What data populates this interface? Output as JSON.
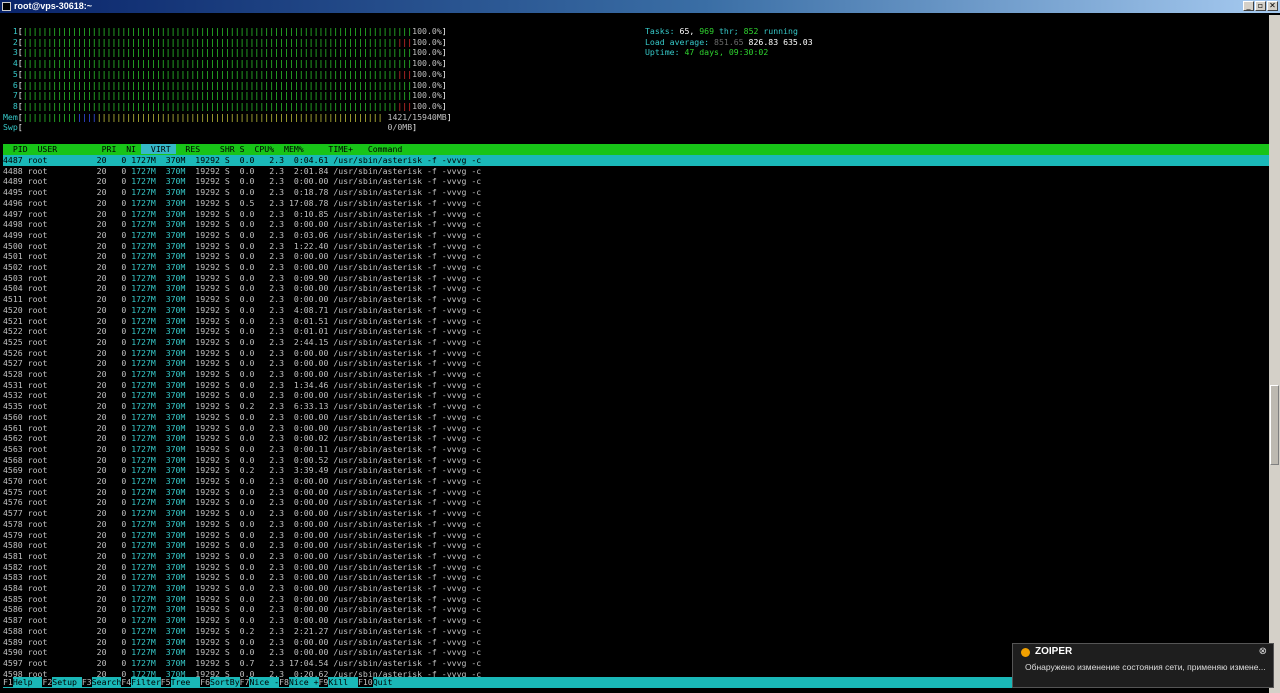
{
  "window": {
    "title": "root@vps-30618:~",
    "controls": [
      "_",
      "▫",
      "✕"
    ]
  },
  "htop": {
    "cpus": [
      {
        "id": "1",
        "percent": "100.0%"
      },
      {
        "id": "2",
        "percent": "100.0%"
      },
      {
        "id": "3",
        "percent": "100.0%"
      },
      {
        "id": "4",
        "percent": "100.0%"
      },
      {
        "id": "5",
        "percent": "100.0%"
      },
      {
        "id": "6",
        "percent": "100.0%"
      },
      {
        "id": "7",
        "percent": "100.0%"
      },
      {
        "id": "8",
        "percent": "100.0%"
      }
    ],
    "mem": {
      "label": "Mem",
      "value": "1421/15940MB"
    },
    "swp": {
      "label": "Swp",
      "value": "0/0MB"
    },
    "tasks": {
      "label": "Tasks:",
      "count": "65,",
      "threads": "969",
      "thr_label": "thr;",
      "running": "852",
      "running_label": "running"
    },
    "load": {
      "label": "Load average:",
      "v1": "851.65",
      "v5": "826.83",
      "v15": "635.03"
    },
    "uptime": {
      "label": "Uptime:",
      "value": "47 days, 09:30:02"
    },
    "columns": [
      "PID",
      "USER",
      "PRI",
      "NI",
      "VIRT",
      "RES",
      "SHR",
      "S",
      "CPU%",
      "MEM%",
      "TIME+",
      "Command"
    ],
    "sort_column": "VIRT",
    "processes": [
      {
        "pid": "4487",
        "user": "root",
        "pri": "20",
        "ni": "0",
        "virt": "1727M",
        "res": "370M",
        "shr": "19292",
        "s": "S",
        "cpu": "0.0",
        "mem": "2.3",
        "time": "0:04.61",
        "cmd": "/usr/sbin/asterisk -f -vvvg -c"
      },
      {
        "pid": "4488",
        "user": "root",
        "pri": "20",
        "ni": "0",
        "virt": "1727M",
        "res": "370M",
        "shr": "19292",
        "s": "S",
        "cpu": "0.0",
        "mem": "2.3",
        "time": "2:01.84",
        "cmd": "/usr/sbin/asterisk -f -vvvg -c"
      },
      {
        "pid": "4489",
        "user": "root",
        "pri": "20",
        "ni": "0",
        "virt": "1727M",
        "res": "370M",
        "shr": "19292",
        "s": "S",
        "cpu": "0.0",
        "mem": "2.3",
        "time": "0:00.00",
        "cmd": "/usr/sbin/asterisk -f -vvvg -c"
      },
      {
        "pid": "4495",
        "user": "root",
        "pri": "20",
        "ni": "0",
        "virt": "1727M",
        "res": "370M",
        "shr": "19292",
        "s": "S",
        "cpu": "0.0",
        "mem": "2.3",
        "time": "0:18.78",
        "cmd": "/usr/sbin/asterisk -f -vvvg -c"
      },
      {
        "pid": "4496",
        "user": "root",
        "pri": "20",
        "ni": "0",
        "virt": "1727M",
        "res": "370M",
        "shr": "19292",
        "s": "S",
        "cpu": "0.5",
        "mem": "2.3",
        "time": "17:08.78",
        "cmd": "/usr/sbin/asterisk -f -vvvg -c"
      },
      {
        "pid": "4497",
        "user": "root",
        "pri": "20",
        "ni": "0",
        "virt": "1727M",
        "res": "370M",
        "shr": "19292",
        "s": "S",
        "cpu": "0.0",
        "mem": "2.3",
        "time": "0:10.85",
        "cmd": "/usr/sbin/asterisk -f -vvvg -c"
      },
      {
        "pid": "4498",
        "user": "root",
        "pri": "20",
        "ni": "0",
        "virt": "1727M",
        "res": "370M",
        "shr": "19292",
        "s": "S",
        "cpu": "0.0",
        "mem": "2.3",
        "time": "0:00.00",
        "cmd": "/usr/sbin/asterisk -f -vvvg -c"
      },
      {
        "pid": "4499",
        "user": "root",
        "pri": "20",
        "ni": "0",
        "virt": "1727M",
        "res": "370M",
        "shr": "19292",
        "s": "S",
        "cpu": "0.0",
        "mem": "2.3",
        "time": "0:03.06",
        "cmd": "/usr/sbin/asterisk -f -vvvg -c"
      },
      {
        "pid": "4500",
        "user": "root",
        "pri": "20",
        "ni": "0",
        "virt": "1727M",
        "res": "370M",
        "shr": "19292",
        "s": "S",
        "cpu": "0.0",
        "mem": "2.3",
        "time": "1:22.40",
        "cmd": "/usr/sbin/asterisk -f -vvvg -c"
      },
      {
        "pid": "4501",
        "user": "root",
        "pri": "20",
        "ni": "0",
        "virt": "1727M",
        "res": "370M",
        "shr": "19292",
        "s": "S",
        "cpu": "0.0",
        "mem": "2.3",
        "time": "0:00.00",
        "cmd": "/usr/sbin/asterisk -f -vvvg -c"
      },
      {
        "pid": "4502",
        "user": "root",
        "pri": "20",
        "ni": "0",
        "virt": "1727M",
        "res": "370M",
        "shr": "19292",
        "s": "S",
        "cpu": "0.0",
        "mem": "2.3",
        "time": "0:00.00",
        "cmd": "/usr/sbin/asterisk -f -vvvg -c"
      },
      {
        "pid": "4503",
        "user": "root",
        "pri": "20",
        "ni": "0",
        "virt": "1727M",
        "res": "370M",
        "shr": "19292",
        "s": "S",
        "cpu": "0.0",
        "mem": "2.3",
        "time": "0:09.90",
        "cmd": "/usr/sbin/asterisk -f -vvvg -c"
      },
      {
        "pid": "4504",
        "user": "root",
        "pri": "20",
        "ni": "0",
        "virt": "1727M",
        "res": "370M",
        "shr": "19292",
        "s": "S",
        "cpu": "0.0",
        "mem": "2.3",
        "time": "0:00.00",
        "cmd": "/usr/sbin/asterisk -f -vvvg -c"
      },
      {
        "pid": "4511",
        "user": "root",
        "pri": "20",
        "ni": "0",
        "virt": "1727M",
        "res": "370M",
        "shr": "19292",
        "s": "S",
        "cpu": "0.0",
        "mem": "2.3",
        "time": "0:00.00",
        "cmd": "/usr/sbin/asterisk -f -vvvg -c"
      },
      {
        "pid": "4520",
        "user": "root",
        "pri": "20",
        "ni": "0",
        "virt": "1727M",
        "res": "370M",
        "shr": "19292",
        "s": "S",
        "cpu": "0.0",
        "mem": "2.3",
        "time": "4:08.71",
        "cmd": "/usr/sbin/asterisk -f -vvvg -c"
      },
      {
        "pid": "4521",
        "user": "root",
        "pri": "20",
        "ni": "0",
        "virt": "1727M",
        "res": "370M",
        "shr": "19292",
        "s": "S",
        "cpu": "0.0",
        "mem": "2.3",
        "time": "0:01.51",
        "cmd": "/usr/sbin/asterisk -f -vvvg -c"
      },
      {
        "pid": "4522",
        "user": "root",
        "pri": "20",
        "ni": "0",
        "virt": "1727M",
        "res": "370M",
        "shr": "19292",
        "s": "S",
        "cpu": "0.0",
        "mem": "2.3",
        "time": "0:01.01",
        "cmd": "/usr/sbin/asterisk -f -vvvg -c"
      },
      {
        "pid": "4525",
        "user": "root",
        "pri": "20",
        "ni": "0",
        "virt": "1727M",
        "res": "370M",
        "shr": "19292",
        "s": "S",
        "cpu": "0.0",
        "mem": "2.3",
        "time": "2:44.15",
        "cmd": "/usr/sbin/asterisk -f -vvvg -c"
      },
      {
        "pid": "4526",
        "user": "root",
        "pri": "20",
        "ni": "0",
        "virt": "1727M",
        "res": "370M",
        "shr": "19292",
        "s": "S",
        "cpu": "0.0",
        "mem": "2.3",
        "time": "0:00.00",
        "cmd": "/usr/sbin/asterisk -f -vvvg -c"
      },
      {
        "pid": "4527",
        "user": "root",
        "pri": "20",
        "ni": "0",
        "virt": "1727M",
        "res": "370M",
        "shr": "19292",
        "s": "S",
        "cpu": "0.0",
        "mem": "2.3",
        "time": "0:00.00",
        "cmd": "/usr/sbin/asterisk -f -vvvg -c"
      },
      {
        "pid": "4528",
        "user": "root",
        "pri": "20",
        "ni": "0",
        "virt": "1727M",
        "res": "370M",
        "shr": "19292",
        "s": "S",
        "cpu": "0.0",
        "mem": "2.3",
        "time": "0:00.00",
        "cmd": "/usr/sbin/asterisk -f -vvvg -c"
      },
      {
        "pid": "4531",
        "user": "root",
        "pri": "20",
        "ni": "0",
        "virt": "1727M",
        "res": "370M",
        "shr": "19292",
        "s": "S",
        "cpu": "0.0",
        "mem": "2.3",
        "time": "1:34.46",
        "cmd": "/usr/sbin/asterisk -f -vvvg -c"
      },
      {
        "pid": "4532",
        "user": "root",
        "pri": "20",
        "ni": "0",
        "virt": "1727M",
        "res": "370M",
        "shr": "19292",
        "s": "S",
        "cpu": "0.0",
        "mem": "2.3",
        "time": "0:00.00",
        "cmd": "/usr/sbin/asterisk -f -vvvg -c"
      },
      {
        "pid": "4535",
        "user": "root",
        "pri": "20",
        "ni": "0",
        "virt": "1727M",
        "res": "370M",
        "shr": "19292",
        "s": "S",
        "cpu": "0.2",
        "mem": "2.3",
        "time": "6:33.13",
        "cmd": "/usr/sbin/asterisk -f -vvvg -c"
      },
      {
        "pid": "4560",
        "user": "root",
        "pri": "20",
        "ni": "0",
        "virt": "1727M",
        "res": "370M",
        "shr": "19292",
        "s": "S",
        "cpu": "0.0",
        "mem": "2.3",
        "time": "0:00.00",
        "cmd": "/usr/sbin/asterisk -f -vvvg -c"
      },
      {
        "pid": "4561",
        "user": "root",
        "pri": "20",
        "ni": "0",
        "virt": "1727M",
        "res": "370M",
        "shr": "19292",
        "s": "S",
        "cpu": "0.0",
        "mem": "2.3",
        "time": "0:00.00",
        "cmd": "/usr/sbin/asterisk -f -vvvg -c"
      },
      {
        "pid": "4562",
        "user": "root",
        "pri": "20",
        "ni": "0",
        "virt": "1727M",
        "res": "370M",
        "shr": "19292",
        "s": "S",
        "cpu": "0.0",
        "mem": "2.3",
        "time": "0:00.02",
        "cmd": "/usr/sbin/asterisk -f -vvvg -c"
      },
      {
        "pid": "4563",
        "user": "root",
        "pri": "20",
        "ni": "0",
        "virt": "1727M",
        "res": "370M",
        "shr": "19292",
        "s": "S",
        "cpu": "0.0",
        "mem": "2.3",
        "time": "0:00.11",
        "cmd": "/usr/sbin/asterisk -f -vvvg -c"
      },
      {
        "pid": "4568",
        "user": "root",
        "pri": "20",
        "ni": "0",
        "virt": "1727M",
        "res": "370M",
        "shr": "19292",
        "s": "S",
        "cpu": "0.0",
        "mem": "2.3",
        "time": "0:00.52",
        "cmd": "/usr/sbin/asterisk -f -vvvg -c"
      },
      {
        "pid": "4569",
        "user": "root",
        "pri": "20",
        "ni": "0",
        "virt": "1727M",
        "res": "370M",
        "shr": "19292",
        "s": "S",
        "cpu": "0.2",
        "mem": "2.3",
        "time": "3:39.49",
        "cmd": "/usr/sbin/asterisk -f -vvvg -c"
      },
      {
        "pid": "4570",
        "user": "root",
        "pri": "20",
        "ni": "0",
        "virt": "1727M",
        "res": "370M",
        "shr": "19292",
        "s": "S",
        "cpu": "0.0",
        "mem": "2.3",
        "time": "0:00.00",
        "cmd": "/usr/sbin/asterisk -f -vvvg -c"
      },
      {
        "pid": "4575",
        "user": "root",
        "pri": "20",
        "ni": "0",
        "virt": "1727M",
        "res": "370M",
        "shr": "19292",
        "s": "S",
        "cpu": "0.0",
        "mem": "2.3",
        "time": "0:00.00",
        "cmd": "/usr/sbin/asterisk -f -vvvg -c"
      },
      {
        "pid": "4576",
        "user": "root",
        "pri": "20",
        "ni": "0",
        "virt": "1727M",
        "res": "370M",
        "shr": "19292",
        "s": "S",
        "cpu": "0.0",
        "mem": "2.3",
        "time": "0:00.00",
        "cmd": "/usr/sbin/asterisk -f -vvvg -c"
      },
      {
        "pid": "4577",
        "user": "root",
        "pri": "20",
        "ni": "0",
        "virt": "1727M",
        "res": "370M",
        "shr": "19292",
        "s": "S",
        "cpu": "0.0",
        "mem": "2.3",
        "time": "0:00.00",
        "cmd": "/usr/sbin/asterisk -f -vvvg -c"
      },
      {
        "pid": "4578",
        "user": "root",
        "pri": "20",
        "ni": "0",
        "virt": "1727M",
        "res": "370M",
        "shr": "19292",
        "s": "S",
        "cpu": "0.0",
        "mem": "2.3",
        "time": "0:00.00",
        "cmd": "/usr/sbin/asterisk -f -vvvg -c"
      },
      {
        "pid": "4579",
        "user": "root",
        "pri": "20",
        "ni": "0",
        "virt": "1727M",
        "res": "370M",
        "shr": "19292",
        "s": "S",
        "cpu": "0.0",
        "mem": "2.3",
        "time": "0:00.00",
        "cmd": "/usr/sbin/asterisk -f -vvvg -c"
      },
      {
        "pid": "4580",
        "user": "root",
        "pri": "20",
        "ni": "0",
        "virt": "1727M",
        "res": "370M",
        "shr": "19292",
        "s": "S",
        "cpu": "0.0",
        "mem": "2.3",
        "time": "0:00.00",
        "cmd": "/usr/sbin/asterisk -f -vvvg -c"
      },
      {
        "pid": "4581",
        "user": "root",
        "pri": "20",
        "ni": "0",
        "virt": "1727M",
        "res": "370M",
        "shr": "19292",
        "s": "S",
        "cpu": "0.0",
        "mem": "2.3",
        "time": "0:00.00",
        "cmd": "/usr/sbin/asterisk -f -vvvg -c"
      },
      {
        "pid": "4582",
        "user": "root",
        "pri": "20",
        "ni": "0",
        "virt": "1727M",
        "res": "370M",
        "shr": "19292",
        "s": "S",
        "cpu": "0.0",
        "mem": "2.3",
        "time": "0:00.00",
        "cmd": "/usr/sbin/asterisk -f -vvvg -c"
      },
      {
        "pid": "4583",
        "user": "root",
        "pri": "20",
        "ni": "0",
        "virt": "1727M",
        "res": "370M",
        "shr": "19292",
        "s": "S",
        "cpu": "0.0",
        "mem": "2.3",
        "time": "0:00.00",
        "cmd": "/usr/sbin/asterisk -f -vvvg -c"
      },
      {
        "pid": "4584",
        "user": "root",
        "pri": "20",
        "ni": "0",
        "virt": "1727M",
        "res": "370M",
        "shr": "19292",
        "s": "S",
        "cpu": "0.0",
        "mem": "2.3",
        "time": "0:00.00",
        "cmd": "/usr/sbin/asterisk -f -vvvg -c"
      },
      {
        "pid": "4585",
        "user": "root",
        "pri": "20",
        "ni": "0",
        "virt": "1727M",
        "res": "370M",
        "shr": "19292",
        "s": "S",
        "cpu": "0.0",
        "mem": "2.3",
        "time": "0:00.00",
        "cmd": "/usr/sbin/asterisk -f -vvvg -c"
      },
      {
        "pid": "4586",
        "user": "root",
        "pri": "20",
        "ni": "0",
        "virt": "1727M",
        "res": "370M",
        "shr": "19292",
        "s": "S",
        "cpu": "0.0",
        "mem": "2.3",
        "time": "0:00.00",
        "cmd": "/usr/sbin/asterisk -f -vvvg -c"
      },
      {
        "pid": "4587",
        "user": "root",
        "pri": "20",
        "ni": "0",
        "virt": "1727M",
        "res": "370M",
        "shr": "19292",
        "s": "S",
        "cpu": "0.0",
        "mem": "2.3",
        "time": "0:00.00",
        "cmd": "/usr/sbin/asterisk -f -vvvg -c"
      },
      {
        "pid": "4588",
        "user": "root",
        "pri": "20",
        "ni": "0",
        "virt": "1727M",
        "res": "370M",
        "shr": "19292",
        "s": "S",
        "cpu": "0.2",
        "mem": "2.3",
        "time": "2:21.27",
        "cmd": "/usr/sbin/asterisk -f -vvvg -c"
      },
      {
        "pid": "4589",
        "user": "root",
        "pri": "20",
        "ni": "0",
        "virt": "1727M",
        "res": "370M",
        "shr": "19292",
        "s": "S",
        "cpu": "0.0",
        "mem": "2.3",
        "time": "0:00.00",
        "cmd": "/usr/sbin/asterisk -f -vvvg -c"
      },
      {
        "pid": "4590",
        "user": "root",
        "pri": "20",
        "ni": "0",
        "virt": "1727M",
        "res": "370M",
        "shr": "19292",
        "s": "S",
        "cpu": "0.0",
        "mem": "2.3",
        "time": "0:00.00",
        "cmd": "/usr/sbin/asterisk -f -vvvg -c"
      },
      {
        "pid": "4597",
        "user": "root",
        "pri": "20",
        "ni": "0",
        "virt": "1727M",
        "res": "370M",
        "shr": "19292",
        "s": "S",
        "cpu": "0.7",
        "mem": "2.3",
        "time": "17:04.54",
        "cmd": "/usr/sbin/asterisk -f -vvvg -c"
      },
      {
        "pid": "4598",
        "user": "root",
        "pri": "20",
        "ni": "0",
        "virt": "1727M",
        "res": "370M",
        "shr": "19292",
        "s": "S",
        "cpu": "0.0",
        "mem": "2.3",
        "time": "0:20.62",
        "cmd": "/usr/sbin/asterisk -f -vvvg -c"
      }
    ],
    "function_keys": [
      {
        "key": "F1",
        "label": "Help"
      },
      {
        "key": "F2",
        "label": "Setup"
      },
      {
        "key": "F3",
        "label": "Search"
      },
      {
        "key": "F4",
        "label": "Filter"
      },
      {
        "key": "F5",
        "label": "Tree"
      },
      {
        "key": "F6",
        "label": "SortBy"
      },
      {
        "key": "F7",
        "label": "Nice -"
      },
      {
        "key": "F8",
        "label": "Nice +"
      },
      {
        "key": "F9",
        "label": "Kill"
      },
      {
        "key": "F10",
        "label": "Quit"
      }
    ]
  },
  "notification": {
    "app": "ZOIPER",
    "message": "Обнаружено изменение состояния сети, применяю измене...",
    "close": "⊗"
  }
}
